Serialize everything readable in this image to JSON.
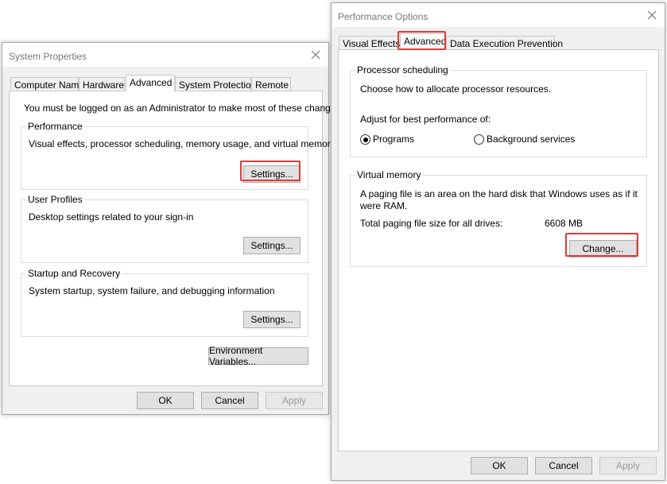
{
  "system_properties": {
    "title": "System Properties",
    "tabs": [
      "Computer Name",
      "Hardware",
      "Advanced",
      "System Protection",
      "Remote"
    ],
    "active_tab": "Advanced",
    "admin_note": "You must be logged on as an Administrator to make most of these changes.",
    "performance": {
      "label": "Performance",
      "description": "Visual effects, processor scheduling, memory usage, and virtual memory",
      "button": "Settings..."
    },
    "user_profiles": {
      "label": "User Profiles",
      "description": "Desktop settings related to your sign-in",
      "button": "Settings..."
    },
    "startup_recovery": {
      "label": "Startup and Recovery",
      "description": "System startup, system failure, and debugging information",
      "button": "Settings..."
    },
    "env_button": "Environment Variables...",
    "ok": "OK",
    "cancel": "Cancel",
    "apply": "Apply"
  },
  "performance_options": {
    "title": "Performance Options",
    "tabs": [
      "Visual Effects",
      "Advanced",
      "Data Execution Prevention"
    ],
    "active_tab": "Advanced",
    "processor_scheduling": {
      "label": "Processor scheduling",
      "description": "Choose how to allocate processor resources.",
      "adjust_label": "Adjust for best performance of:",
      "option_programs": "Programs",
      "option_background": "Background services",
      "selected": "Programs"
    },
    "virtual_memory": {
      "label": "Virtual memory",
      "description_line1": "A paging file is an area on the hard disk that Windows uses as if it",
      "description_line2": "were RAM.",
      "total_label": "Total paging file size for all drives:",
      "total_value": "6608 MB",
      "button": "Change..."
    },
    "ok": "OK",
    "cancel": "Cancel",
    "apply": "Apply"
  },
  "colors": {
    "highlight": "#e03a3a",
    "window_bg": "#f0f0f0",
    "title_text": "#777777"
  }
}
